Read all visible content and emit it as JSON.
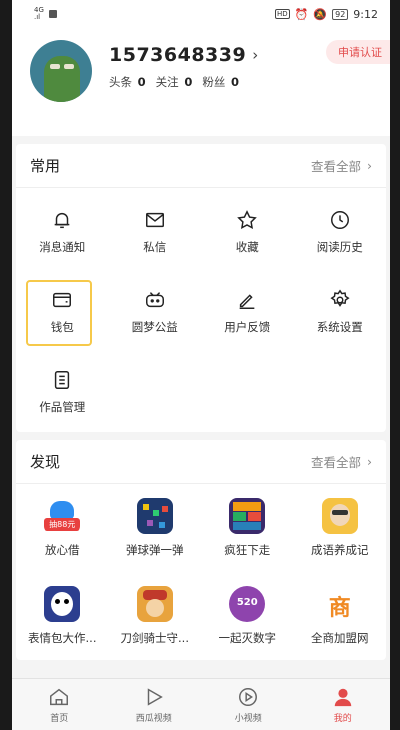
{
  "status_bar": {
    "network": "4G",
    "hd": "HD",
    "battery": "92",
    "time": "9:12"
  },
  "profile": {
    "username": "1573648339",
    "stats": [
      {
        "label": "头条",
        "count": "0"
      },
      {
        "label": "关注",
        "count": "0"
      },
      {
        "label": "粉丝",
        "count": "0"
      }
    ],
    "cert_label": "申请认证"
  },
  "common": {
    "title": "常用",
    "see_all": "查看全部",
    "items": [
      {
        "label": "消息通知",
        "icon": "bell-icon"
      },
      {
        "label": "私信",
        "icon": "mail-icon"
      },
      {
        "label": "收藏",
        "icon": "star-icon"
      },
      {
        "label": "阅读历史",
        "icon": "clock-icon"
      },
      {
        "label": "钱包",
        "icon": "wallet-icon"
      },
      {
        "label": "圆梦公益",
        "icon": "charity-icon"
      },
      {
        "label": "用户反馈",
        "icon": "pen-icon"
      },
      {
        "label": "系统设置",
        "icon": "gear-icon"
      },
      {
        "label": "作品管理",
        "icon": "document-icon"
      }
    ]
  },
  "discover": {
    "title": "发现",
    "see_all": "查看全部",
    "items": [
      {
        "label": "放心借",
        "icon": "loan-app-icon",
        "badge": "抽88元"
      },
      {
        "label": "弹球弹一弹",
        "icon": "pinball-game-icon"
      },
      {
        "label": "疯狂下走",
        "icon": "block-game-icon"
      },
      {
        "label": "成语养成记",
        "icon": "idiom-game-icon"
      },
      {
        "label": "表情包大作...",
        "icon": "meme-app-icon"
      },
      {
        "label": "刀剑骑士守...",
        "icon": "knight-game-icon"
      },
      {
        "label": "一起灭数字",
        "icon": "number-game-icon",
        "badge": "520"
      },
      {
        "label": "全商加盟网",
        "icon": "franchise-app-icon",
        "badge": "商"
      }
    ]
  },
  "nav": [
    {
      "label": "首页",
      "icon": "home-icon"
    },
    {
      "label": "西瓜视频",
      "icon": "play-icon"
    },
    {
      "label": "小视频",
      "icon": "short-video-icon"
    },
    {
      "label": "我的",
      "icon": "user-icon"
    }
  ],
  "colors": {
    "accent": "#e24b4b",
    "highlight": "#f6c94a"
  }
}
